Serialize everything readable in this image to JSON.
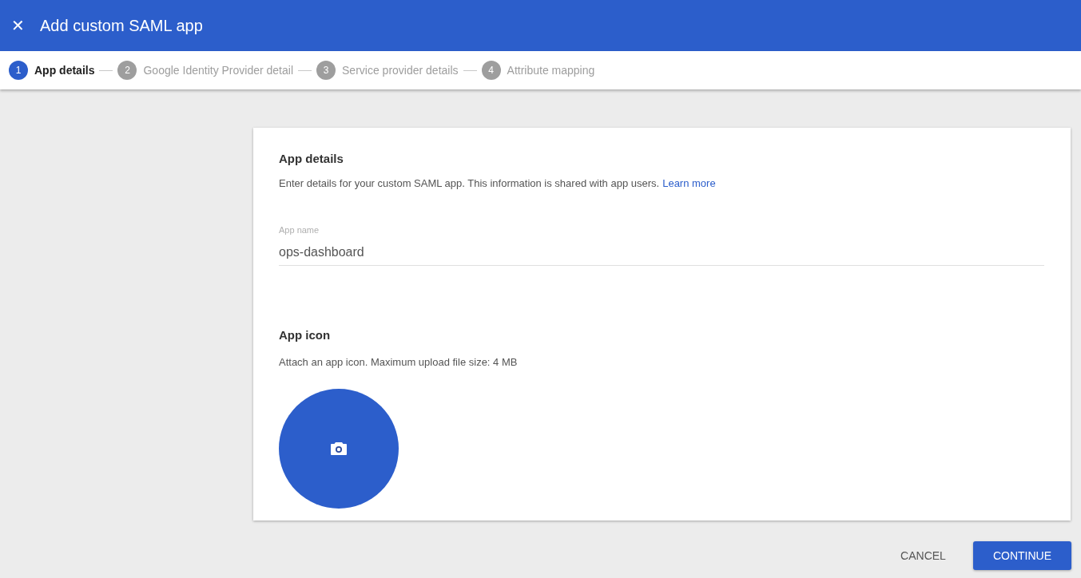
{
  "header": {
    "close_glyph": "✕",
    "title": "Add custom SAML app"
  },
  "steps": [
    {
      "number": "1",
      "label": "App details",
      "selected": true
    },
    {
      "number": "2",
      "label": "Google Identity Provider detail",
      "selected": false
    },
    {
      "number": "3",
      "label": "Service provider details",
      "selected": false
    },
    {
      "number": "4",
      "label": "Attribute mapping",
      "selected": false
    }
  ],
  "card": {
    "title": "App details",
    "description": "Enter details for your custom SAML app. This information is shared with app users.",
    "link": "Learn more",
    "field": {
      "label": "App name",
      "value": "ops-dashboard"
    },
    "icon_section": {
      "title": "App icon",
      "description": "Attach an app icon. Maximum upload file size: 4 MB"
    }
  },
  "buttons": [
    {
      "label": "CANCEL",
      "kind": "text"
    },
    {
      "label": "CONTINUE",
      "kind": "primary"
    }
  ]
}
